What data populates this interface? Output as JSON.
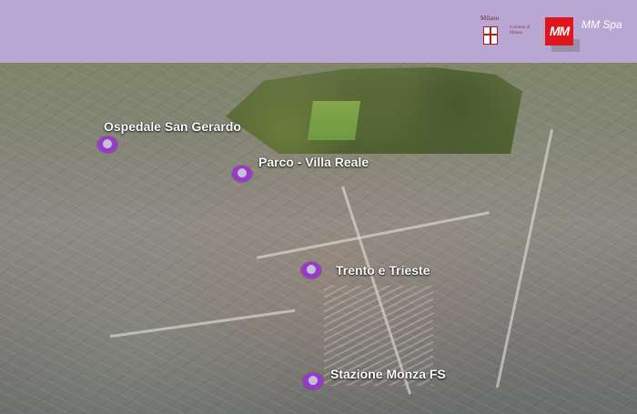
{
  "header": {
    "background": "#b9a6d3",
    "logos": {
      "milano": {
        "wordmark": "Milano",
        "caption": "Comune di Milano",
        "icon": "milano-crest-icon"
      },
      "mm": {
        "mark": "MM",
        "name": "MM Spa",
        "color": "#e0161f"
      }
    }
  },
  "map": {
    "type": "aerial-city-view",
    "locations": [
      {
        "label": "Ospedale San Gerardo"
      },
      {
        "label": "Parco - Villa Reale"
      },
      {
        "label": "Trento e Trieste"
      },
      {
        "label": "Stazione Monza FS"
      }
    ],
    "marker_color": "#9a38c9"
  }
}
